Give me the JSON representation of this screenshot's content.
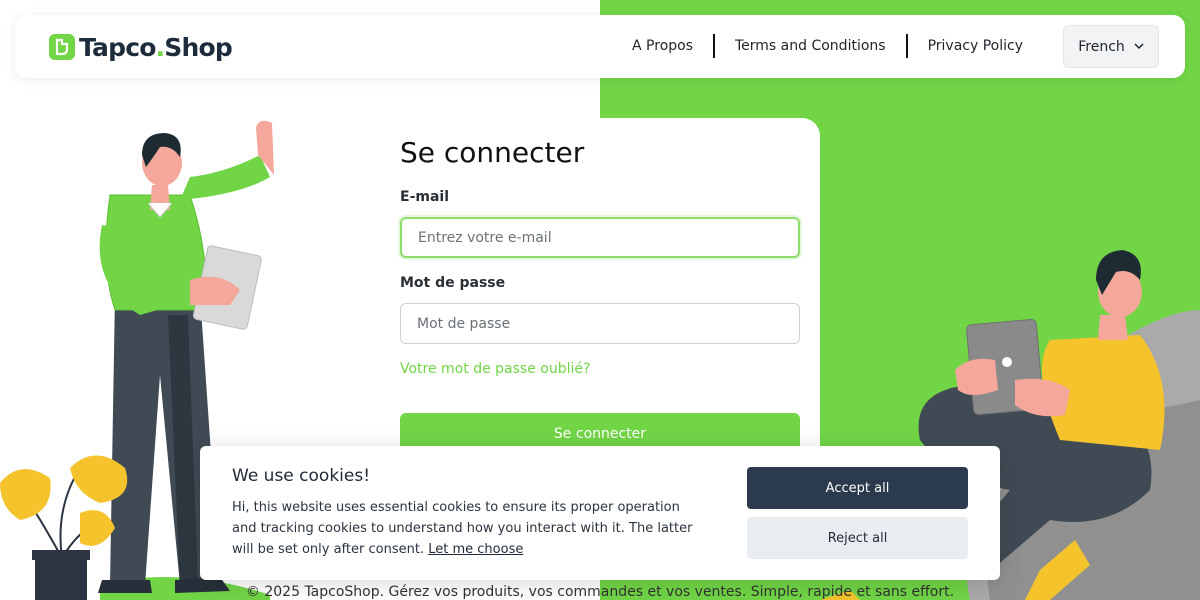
{
  "brand": {
    "name_part1": "Tapco",
    "name_part2": "Shop",
    "dot": "."
  },
  "nav": {
    "links": [
      "A Propos",
      "Terms and Conditions",
      "Privacy Policy"
    ],
    "language": "French"
  },
  "login": {
    "title": "Se connecter",
    "email_label": "E-mail",
    "email_placeholder": "Entrez votre e-mail",
    "email_value": "",
    "password_label": "Mot de passe",
    "password_placeholder": "Mot de passe",
    "password_value": "",
    "forgot_link": "Votre mot de passe oublié?",
    "submit_label": "Se connecter"
  },
  "footer": {
    "text": "© 2025 TapcoShop. Gérez vos produits, vos commandes et vos ventes. Simple, rapide et sans effort."
  },
  "cookie": {
    "title": "We use cookies!",
    "text": "Hi, this website uses essential cookies to ensure its proper operation and tracking cookies to understand how you interact with it. The latter will be set only after consent.",
    "link": "Let me choose",
    "accept_label": "Accept all",
    "reject_label": "Reject all"
  },
  "colors": {
    "brand_green": "#71d546",
    "dark_navy": "#2b3a4d",
    "light_gray": "#e9edf1"
  },
  "icons": [
    "logo-mark-icon",
    "chevron-down-icon"
  ],
  "illustrations": [
    "man-standing-with-tablet",
    "man-sitting-with-tablet",
    "potted-monstera-plant"
  ]
}
